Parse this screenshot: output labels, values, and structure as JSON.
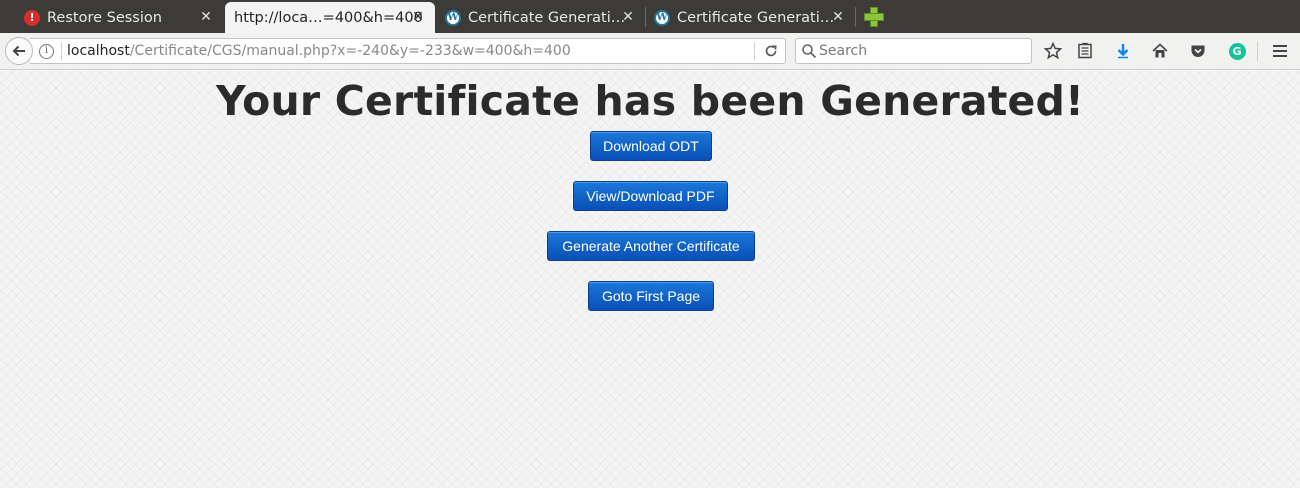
{
  "tabs": [
    {
      "title": "Restore Session",
      "icon": "warning-icon"
    },
    {
      "title": "http://loca…=400&h=400",
      "icon": "none",
      "active": true
    },
    {
      "title": "Certificate Generati…",
      "icon": "wordpress-icon"
    },
    {
      "title": "Certificate Generati…",
      "icon": "wordpress-icon"
    }
  ],
  "address": {
    "host": "localhost",
    "path": "/Certificate/CGS/manual.php?x=-240&y=-233&w=400&h=400"
  },
  "search": {
    "placeholder": "Search"
  },
  "page": {
    "headline": "Your Certificate has been Generated!",
    "buttons": {
      "download_odt": "Download ODT",
      "view_pdf": "View/Download PDF",
      "generate_another": "Generate Another Certificate",
      "first_page": "Goto First Page"
    }
  },
  "colors": {
    "button": "#0b5ac4",
    "tabstrip": "#3c3b37",
    "grammarly": "#15c39a",
    "download_arrow": "#0a84ff"
  }
}
